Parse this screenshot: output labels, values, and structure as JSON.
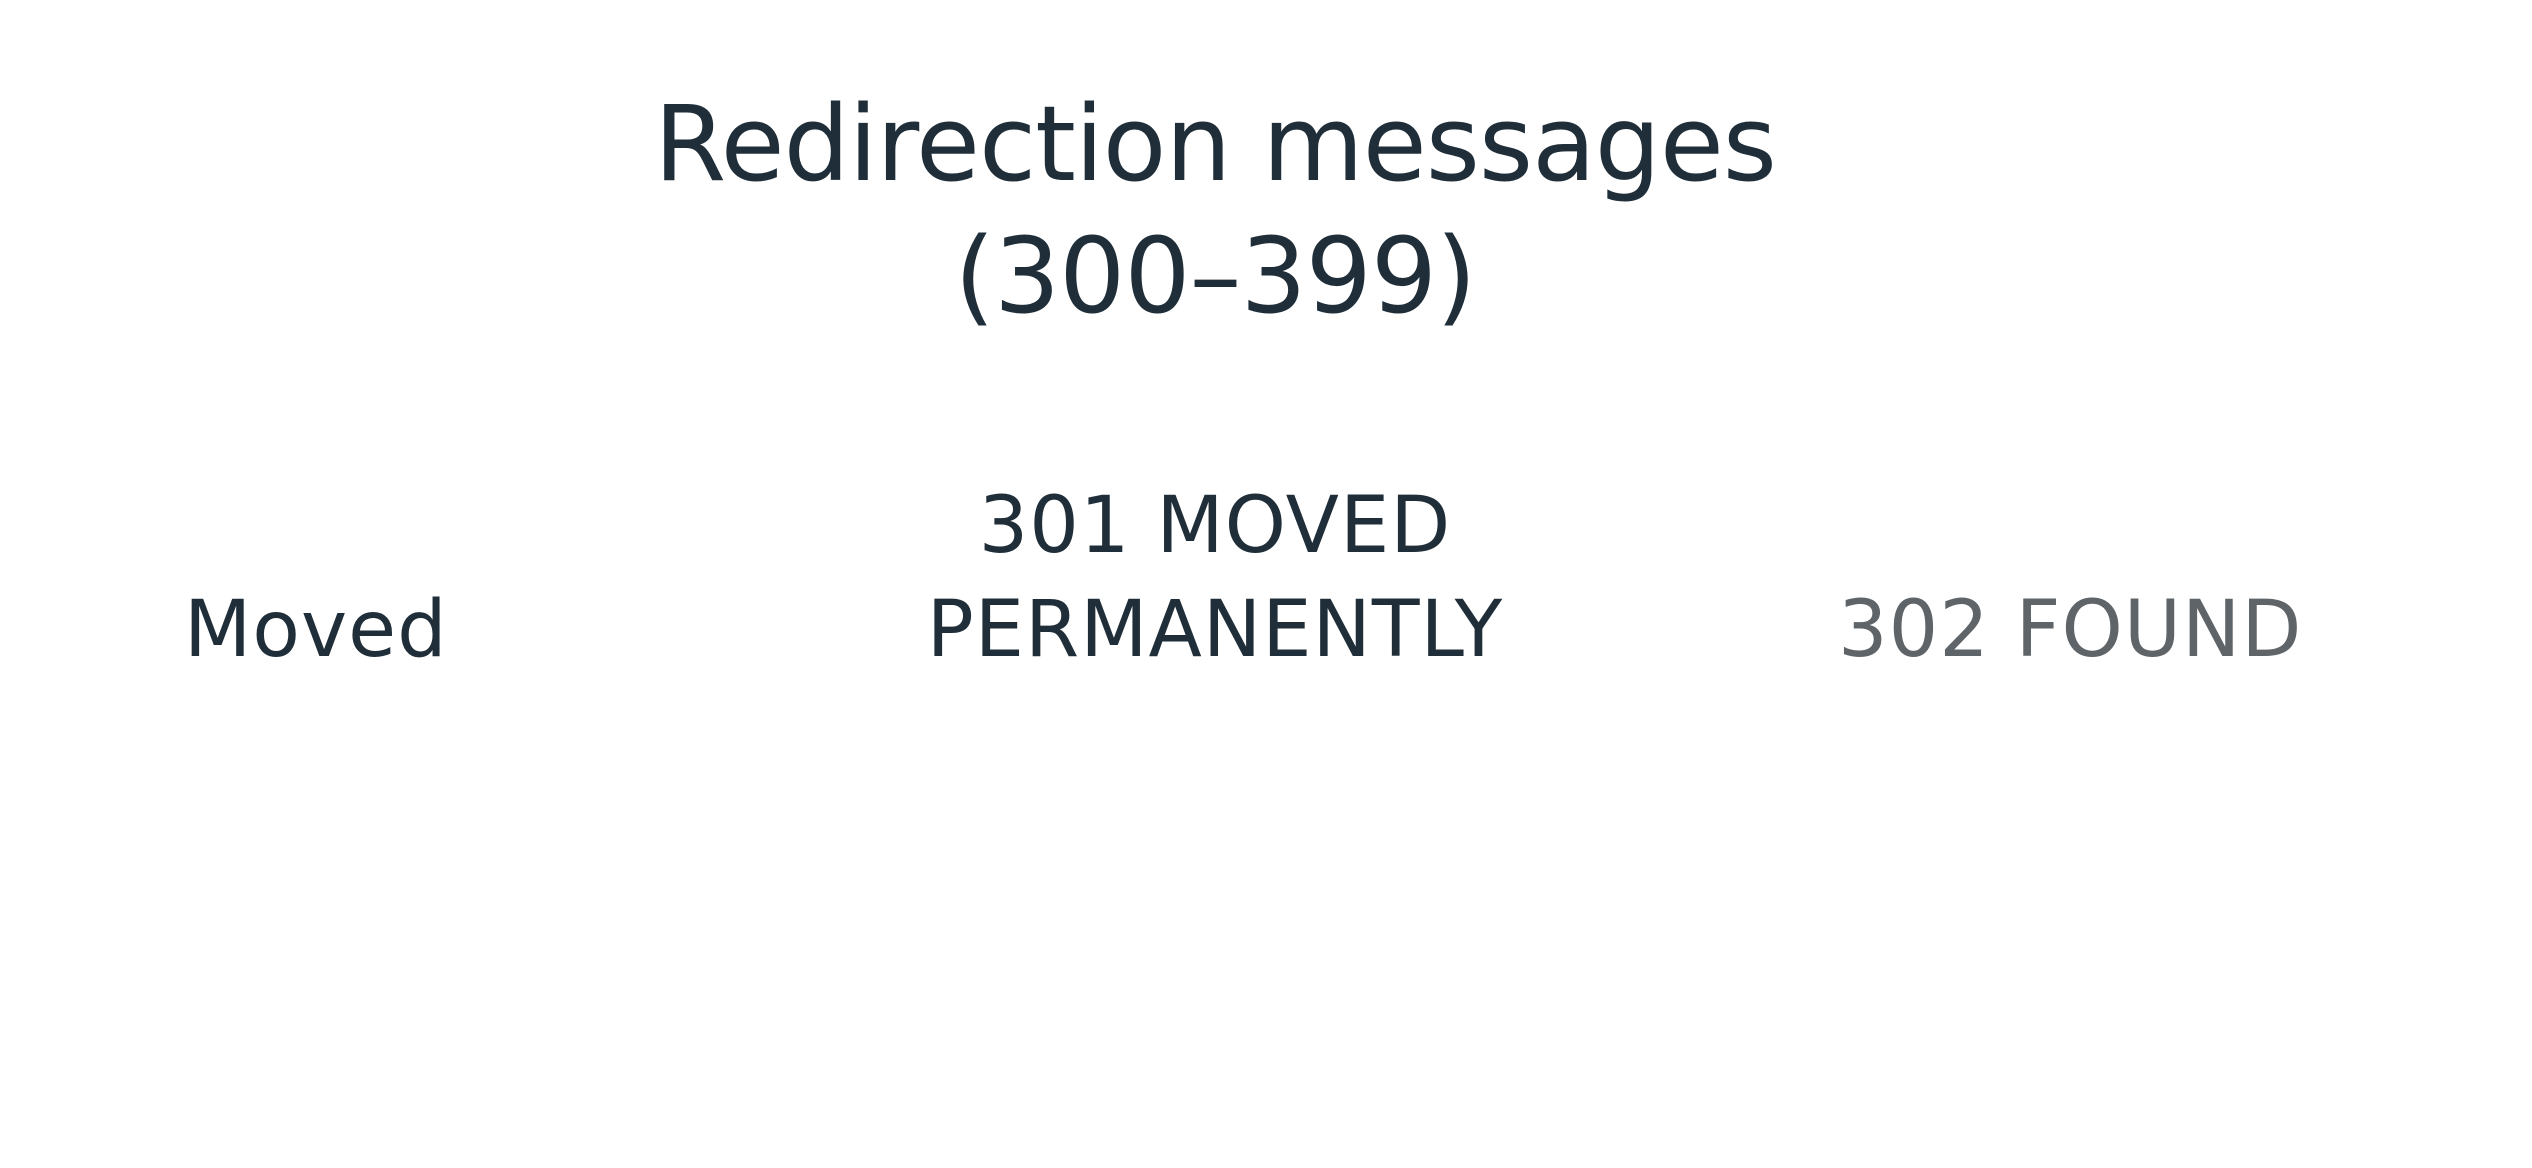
{
  "slide": {
    "title_line1": "Redirection messages",
    "title_line2": "(300–399)",
    "terms": {
      "left": "Moved",
      "center_line1": "301 MOVED",
      "center_line2": "PERMANENTLY",
      "right": "302 FOUND"
    },
    "colors": {
      "background": "#ffffff",
      "primary_text": "#1f2e39",
      "muted_text": "#5f6469"
    }
  }
}
